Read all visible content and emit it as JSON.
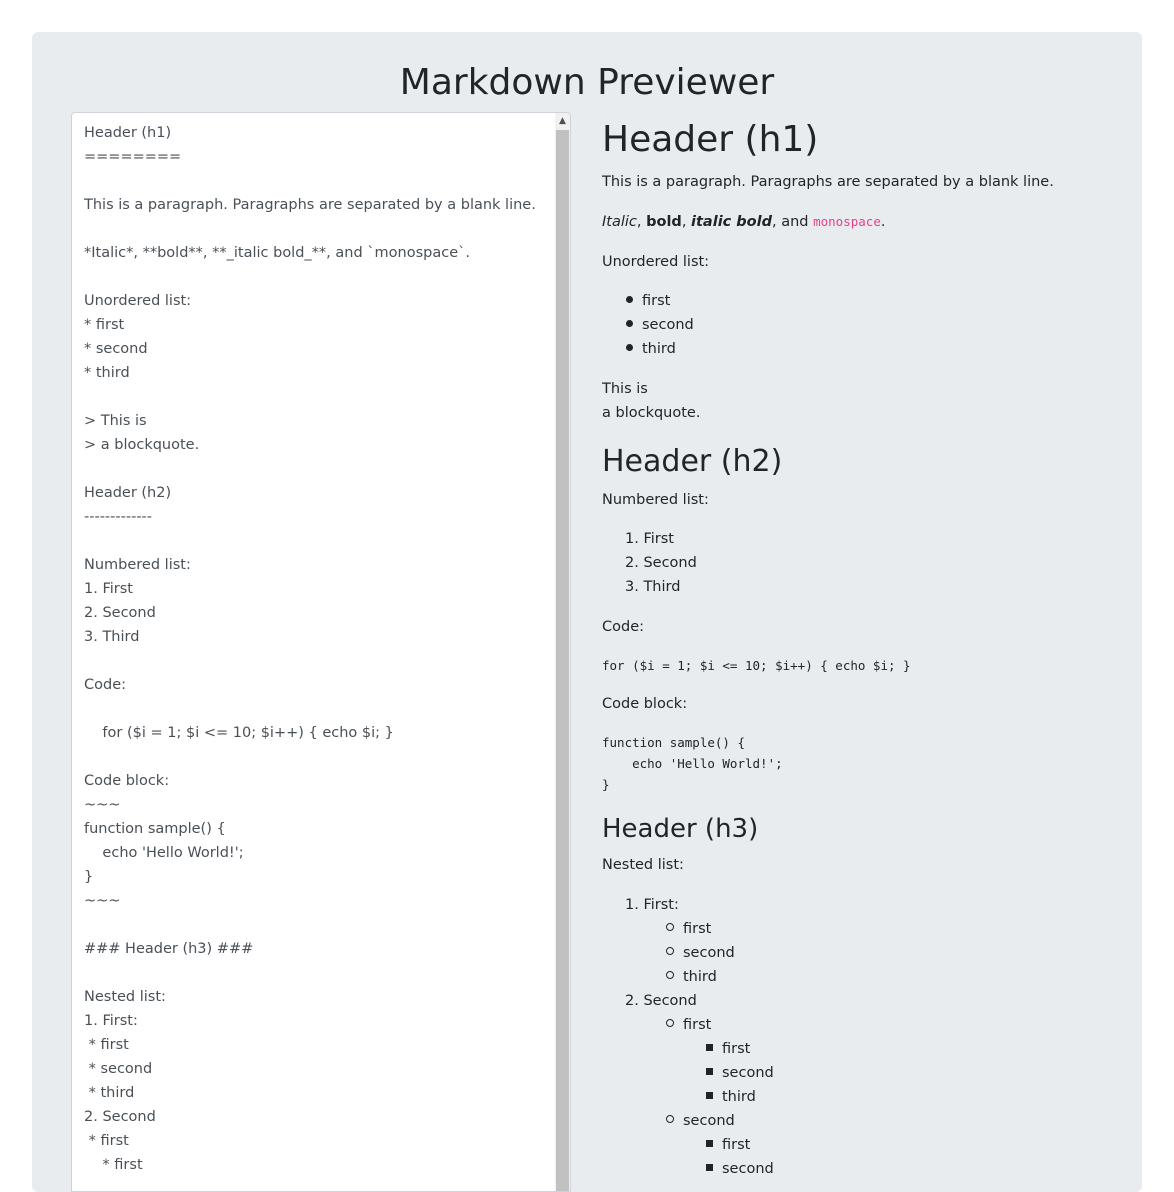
{
  "app": {
    "title": "Markdown Previewer"
  },
  "editor": {
    "text": "Header (h1)\n========\n\nThis is a paragraph. Paragraphs are separated by a blank line.\n\n*Italic*, **bold**, **_italic bold_**, and `monospace`.\n\nUnordered list:\n* first\n* second\n* third\n\n> This is\n> a blockquote.\n\nHeader (h2)\n-------------\n\nNumbered list:\n1. First\n2. Second\n3. Third\n\nCode:\n\n    for ($i = 1; $i <= 10; $i++) { echo $i; }\n\nCode block:\n~~~\nfunction sample() {\n    echo 'Hello World!';\n}\n~~~\n\n### Header (h3) ###\n\nNested list:\n1. First:\n * first\n * second\n * third\n2. Second\n * first\n    * first"
  },
  "preview": {
    "h1": "Header (h1)",
    "paragraph": "This is a paragraph. Paragraphs are separated by a blank line.",
    "emphasis": {
      "italic": "Italic",
      "sep1": ", ",
      "bold": "bold",
      "sep2": ", ",
      "italic_bold": "italic bold",
      "sep3": ", and ",
      "monospace": "monospace",
      "end": "."
    },
    "unordered_label": "Unordered list:",
    "unordered_items": [
      "first",
      "second",
      "third"
    ],
    "blockquote_line1": "This is",
    "blockquote_line2": "a blockquote.",
    "h2": "Header (h2)",
    "numbered_label": "Numbered list:",
    "numbered_items": [
      "1. First",
      "2. Second",
      "3. Third"
    ],
    "code_label": "Code:",
    "code_inline": "for ($i = 1; $i <= 10; $i++) { echo $i; }",
    "code_block_label": "Code block:",
    "code_block": "function sample() {\n    echo 'Hello World!';\n}",
    "h3": "Header (h3)",
    "nested_label": "Nested list:",
    "nested": {
      "item1": "1. First:",
      "item1_children": [
        "first",
        "second",
        "third"
      ],
      "item2": "2. Second",
      "item2_child1": "first",
      "item2_child1_children": [
        "first",
        "second",
        "third"
      ],
      "item2_child2": "second",
      "item2_child2_children": [
        "first",
        "second"
      ]
    }
  }
}
